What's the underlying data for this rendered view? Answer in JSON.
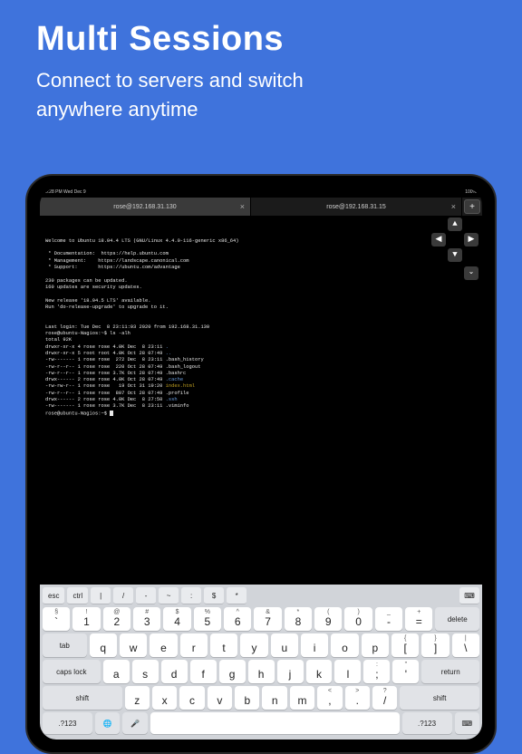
{
  "hero": {
    "title": "Multi Sessions",
    "line1": "Connect to servers and switch",
    "line2": "anywhere anytime"
  },
  "statusbar": {
    "left": "6:28 PM  Wed Dec 9",
    "right": "100%"
  },
  "tabs": {
    "t1": "rose@192.168.31.130",
    "t2": "rose@192.168.31.15",
    "close": "×",
    "add": "+"
  },
  "arrows": {
    "up": "▲",
    "down": "▼",
    "left": "◀",
    "right": "▶",
    "extra": "⌄"
  },
  "term": {
    "l01": "Welcome to Ubuntu 18.04.4 LTS (GNU/Linux 4.4.0-116-generic x86_64)",
    "l02": " * Documentation:  https://help.ubuntu.com",
    "l03": " * Management:    https://landscape.canonical.com",
    "l04": " * Support:       https://ubuntu.com/advantage",
    "l05": "230 packages can be updated.",
    "l06": "160 updates are security updates.",
    "l07": "New release '18.04.5 LTS' available.",
    "l08": "Run 'do-release-upgrade' to upgrade to it.",
    "l09": "Last login: Tue Dec  8 23:11:03 2020 from 192.168.31.130",
    "l10": "rose@ubuntu-Nagios:~$ ls -alh",
    "l11": "total 92K",
    "l12": "drwxr-xr-x 4 rose rose 4.0K Dec  8 23:11 ",
    "l12b": ".",
    "l13": "drwxr-xr-x 5 root root 4.0K Oct 28 07:49 ",
    "l13b": "..",
    "l14": "-rw------- 1 rose rose  272 Dec  8 23:11 .bash_history",
    "l15": "-rw-r--r-- 1 rose rose  220 Oct 28 07:49 .bash_logout",
    "l16": "-rw-r--r-- 1 rose rose 3.7K Oct 28 07:49 .bashrc",
    "l17": "drwx------ 2 rose rose 4.0K Oct 28 07:49 ",
    "l17b": ".cache",
    "l18": "-rw-rw-r-- 1 rose rose   19 Oct 31 19:20 ",
    "l18b": "index.html",
    "l19": "-rw-r--r-- 1 rose rose  807 Oct 28 07:49 .profile",
    "l20": "drwx------ 2 rose rose 4.0K Dec  8 27:50 ",
    "l20b": ".ssh",
    "l21": "-rw------- 1 rose rose 3.7K Dec  8 23:11 .viminfo",
    "l22": "rose@ubuntu-Nagios:~$ "
  },
  "accRow": {
    "esc": "esc",
    "ctrl": "ctrl",
    "pipe": "|",
    "slash": "/",
    "dash": "-",
    "tilde": "~",
    "colon": ":",
    "dollar": "$",
    "star": "*",
    "kb": "⌨"
  },
  "kb": {
    "row1": {
      "k1a": "`",
      "k1b": "§",
      "k2a": "1",
      "k2b": "!",
      "k3a": "2",
      "k3b": "@",
      "k4a": "3",
      "k4b": "#",
      "k5a": "4",
      "k5b": "$",
      "k6a": "5",
      "k6b": "%",
      "k7a": "6",
      "k7b": "^",
      "k8a": "7",
      "k8b": "&",
      "k9a": "8",
      "k9b": "*",
      "k10a": "9",
      "k10b": "(",
      "k11a": "0",
      "k11b": ")",
      "k12a": "-",
      "k12b": "_",
      "k13a": "=",
      "k13b": "+",
      "del": "delete"
    },
    "row2": {
      "tab": "tab",
      "q": "q",
      "w": "w",
      "e": "e",
      "r": "r",
      "t": "t",
      "y": "y",
      "u": "u",
      "i": "i",
      "o": "o",
      "p": "p",
      "lb": "[",
      "lba": "{",
      "rb": "]",
      "rba": "}",
      "bs": "\\",
      "bsa": "|"
    },
    "row3": {
      "caps": "caps lock",
      "a": "a",
      "s": "s",
      "d": "d",
      "f": "f",
      "g": "g",
      "h": "h",
      "j": "j",
      "k": "k",
      "l": "l",
      "sc": ";",
      "sca": ":",
      "qt": "'",
      "qta": "\"",
      "ret": "return"
    },
    "row4": {
      "shiftL": "shift",
      "z": "z",
      "x": "x",
      "c": "c",
      "v": "v",
      "b": "b",
      "n": "n",
      "m": "m",
      "cm": ",",
      "cma": "<",
      "pd": ".",
      "pda": ">",
      "sl": "/",
      "sla": "?",
      "shiftR": "shift"
    },
    "row5": {
      "num": ".?123",
      "globe": "🌐",
      "mic": "🎤",
      "space": "",
      "numR": ".?123",
      "hide": "⌨"
    }
  }
}
